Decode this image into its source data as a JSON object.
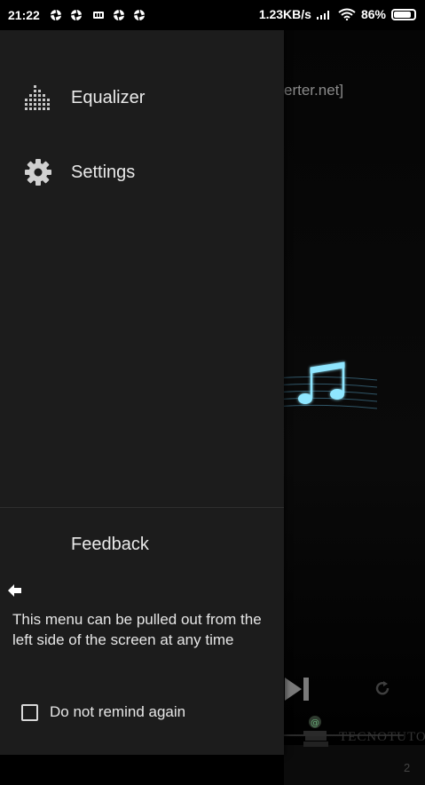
{
  "status_bar": {
    "time": "21:22",
    "net_speed": "1.23KB/s",
    "battery_text": "86%",
    "battery_level": 0.86,
    "icons": [
      "aperture-icon",
      "aperture-icon",
      "notification-icon",
      "aperture-icon",
      "aperture-icon",
      "signal-icon",
      "wifi-icon",
      "battery-icon"
    ]
  },
  "player": {
    "title_partial": "erter.net]",
    "partial_number": "2"
  },
  "drawer": {
    "items": [
      {
        "label": "Equalizer",
        "icon": "equalizer-icon"
      },
      {
        "label": "Settings",
        "icon": "gear-icon"
      }
    ],
    "feedback_label": "Feedback"
  },
  "hint": {
    "text": "This menu can be pulled out from the left side of the screen at any time",
    "remind_label": "Do not remind again",
    "remind_checked": false
  },
  "watermark": {
    "text": "TECNOTUTO"
  },
  "colors": {
    "drawer_bg": "#1c1c1c",
    "background": "#000000",
    "text": "#eaeaea",
    "accent_glow": "#5ad0ff"
  }
}
